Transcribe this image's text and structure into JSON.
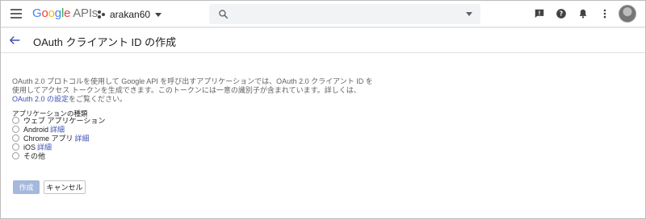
{
  "header": {
    "logo": {
      "google": "Google",
      "apis": "APIs"
    },
    "project_name": "arakan60",
    "search_placeholder": "",
    "icons": [
      "notifications-feedback-icon",
      "help-icon",
      "bell-icon",
      "more-vert-icon"
    ]
  },
  "page": {
    "title": "OAuth クライアント ID の作成"
  },
  "description": {
    "line1": "OAuth 2.0 プロトコルを使用して Google API を呼び出すアプリケーションでは、OAuth 2.0 クライアント ID を",
    "line2": "使用してアクセス トークンを生成できます。このトークンには一意の識別子が含まれています。詳しくは、",
    "link": "OAuth 2.0 の設定",
    "line3_suffix": "をご覧ください。"
  },
  "application_type": {
    "label": "アプリケーションの種類",
    "options": [
      {
        "label": "ウェブ アプリケーション",
        "link": ""
      },
      {
        "label": "Android",
        "link": "詳細"
      },
      {
        "label": "Chrome アプリ",
        "link": "詳細"
      },
      {
        "label": "iOS",
        "link": "詳細"
      },
      {
        "label": "その他",
        "link": ""
      }
    ]
  },
  "actions": {
    "create": "作成",
    "cancel": "キャンセル"
  },
  "colors": {
    "accent": "#3f51b5",
    "create_button_disabled": "#a5b8dd",
    "search_bg": "#f1f3f4"
  }
}
